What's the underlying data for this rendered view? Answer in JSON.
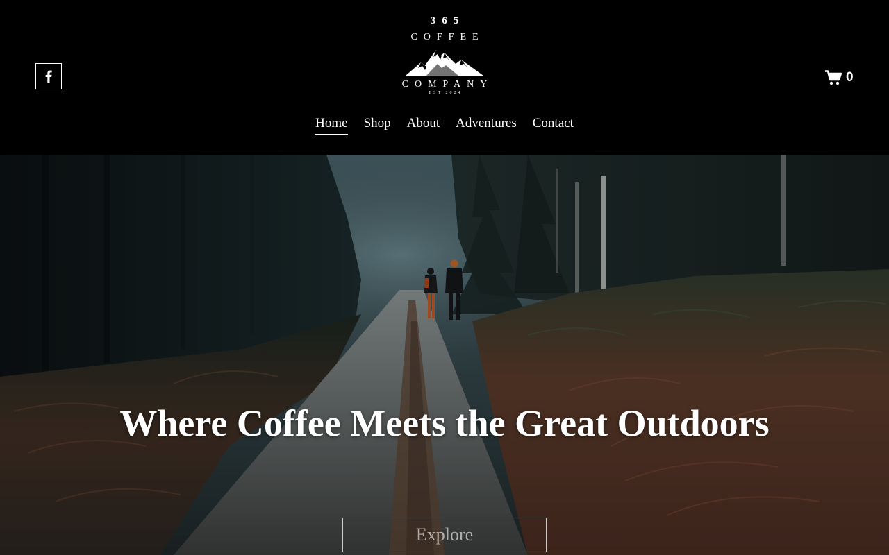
{
  "header": {
    "social": {
      "icon": "facebook-icon"
    },
    "logo": {
      "line1": "365",
      "line2": "COFFEE",
      "line3": "COMPANY",
      "line4": "EST 2024",
      "emblem": "mountains-icon"
    },
    "cart": {
      "icon": "cart-icon",
      "count": "0"
    }
  },
  "nav": {
    "items": [
      {
        "label": "Home",
        "active": true
      },
      {
        "label": "Shop"
      },
      {
        "label": "About"
      },
      {
        "label": "Adventures"
      },
      {
        "label": "Contact"
      }
    ]
  },
  "hero": {
    "headline": "Where Coffee Meets the Great Outdoors",
    "button_label": "Explore"
  },
  "colors": {
    "header_bg": "#000000",
    "text": "#ffffff"
  }
}
